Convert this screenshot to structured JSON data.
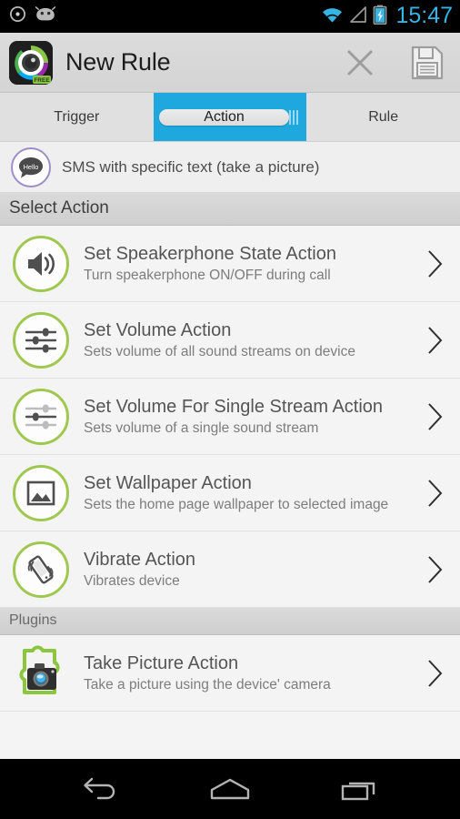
{
  "status_bar": {
    "icons": [
      "circle-dot-icon",
      "android-bean-icon",
      "wifi-icon",
      "cell-signal-icon",
      "battery-charging-icon"
    ],
    "clock": "15:47",
    "accent_color": "#33b5e5",
    "background": "#000000"
  },
  "action_bar": {
    "app_icon": "camera-app-icon",
    "badge": "FREE",
    "title": "New Rule",
    "cancel_label": "close-icon",
    "save_label": "save-icon",
    "background": "#d8d8d8"
  },
  "tabs": {
    "selected_color": "#1fa8dd",
    "items": [
      {
        "label": "Trigger",
        "selected": false
      },
      {
        "label": "Action",
        "selected": true
      },
      {
        "label": "Rule",
        "selected": false
      }
    ]
  },
  "summary": {
    "icon": "sms-hello-icon",
    "icon_text": "Hello",
    "text": "SMS with specific text (take a picture)",
    "accent_color": "#9d8ec8"
  },
  "sections": [
    {
      "header": "Select Action",
      "style": "large",
      "items": [
        {
          "icon": "speaker-icon",
          "title": "Set Speakerphone State Action",
          "subtitle": "Turn speakerphone ON/OFF during call",
          "chevron": "chevron-right-icon"
        },
        {
          "icon": "equalizer-icon",
          "title": "Set Volume Action",
          "subtitle": "Sets volume of all sound streams on device",
          "chevron": "chevron-right-icon"
        },
        {
          "icon": "equalizer-single-icon",
          "title": "Set Volume For Single Stream Action",
          "subtitle": "Sets volume of a single sound stream",
          "chevron": "chevron-right-icon"
        },
        {
          "icon": "image-frame-icon",
          "title": "Set Wallpaper Action",
          "subtitle": "Sets the home page wallpaper to selected image",
          "chevron": "chevron-right-icon"
        },
        {
          "icon": "vibrate-phone-icon",
          "title": "Vibrate Action",
          "subtitle": "Vibrates device",
          "chevron": "chevron-right-icon"
        }
      ]
    },
    {
      "header": "Plugins",
      "style": "small",
      "items": [
        {
          "icon": "camera-plugin-icon",
          "title": "Take Picture Action",
          "subtitle": "Take a picture using the device' camera",
          "chevron": "chevron-right-icon"
        }
      ]
    }
  ],
  "nav_bar": {
    "back": "back-icon",
    "home": "home-icon",
    "recents": "recents-icon"
  },
  "colors": {
    "green_ring": "#a0c850",
    "list_bg": "#f4f4f4",
    "header_bg": "#d5d5d5"
  }
}
